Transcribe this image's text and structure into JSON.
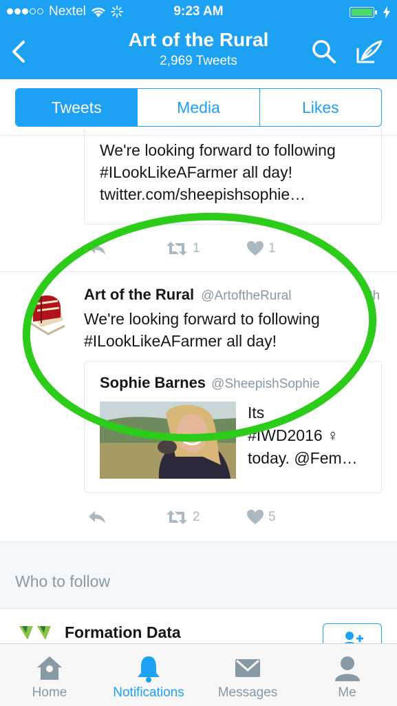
{
  "status_bar": {
    "carrier": "Nextel",
    "time": "9:23 AM"
  },
  "header": {
    "title": "Art of the Rural",
    "tweet_count": "2,969 Tweets"
  },
  "profile_tabs": [
    {
      "label": "Tweets",
      "active": true
    },
    {
      "label": "Media",
      "active": false
    },
    {
      "label": "Likes",
      "active": false
    }
  ],
  "tweet_previous": {
    "quote_text_lines": [
      "We're looking forward to following",
      "#ILookLikeAFarmer all day!",
      "twitter.com/sheepishsophie…"
    ],
    "retweet_count": "1",
    "like_count": "1"
  },
  "tweet_main": {
    "author_name": "Art of the Rural",
    "author_handle": "@ArtoftheRural",
    "time": "2h",
    "text_lines": [
      "We're looking forward to following",
      "#ILookLikeAFarmer all day!"
    ],
    "quoted": {
      "author_name": "Sophie Barnes",
      "author_handle": "@SheepishSophie",
      "text_lines": [
        "Its",
        "#IWD2016 ♀",
        "today. @Fem…"
      ]
    },
    "retweet_count": "2",
    "like_count": "5"
  },
  "who_to_follow": {
    "heading": "Who to follow",
    "suggestion_name": "Formation Data"
  },
  "tab_bar": [
    {
      "label": "Home",
      "icon": "home-icon",
      "active": false
    },
    {
      "label": "Notifications",
      "icon": "bell-icon",
      "active": true
    },
    {
      "label": "Messages",
      "icon": "envelope-icon",
      "active": false
    },
    {
      "label": "Me",
      "icon": "person-icon",
      "active": false
    }
  ],
  "colors": {
    "twitter_blue": "#1da1f2",
    "annotation_circle": "#2ecc1a",
    "battery_green": "#4cd964"
  }
}
